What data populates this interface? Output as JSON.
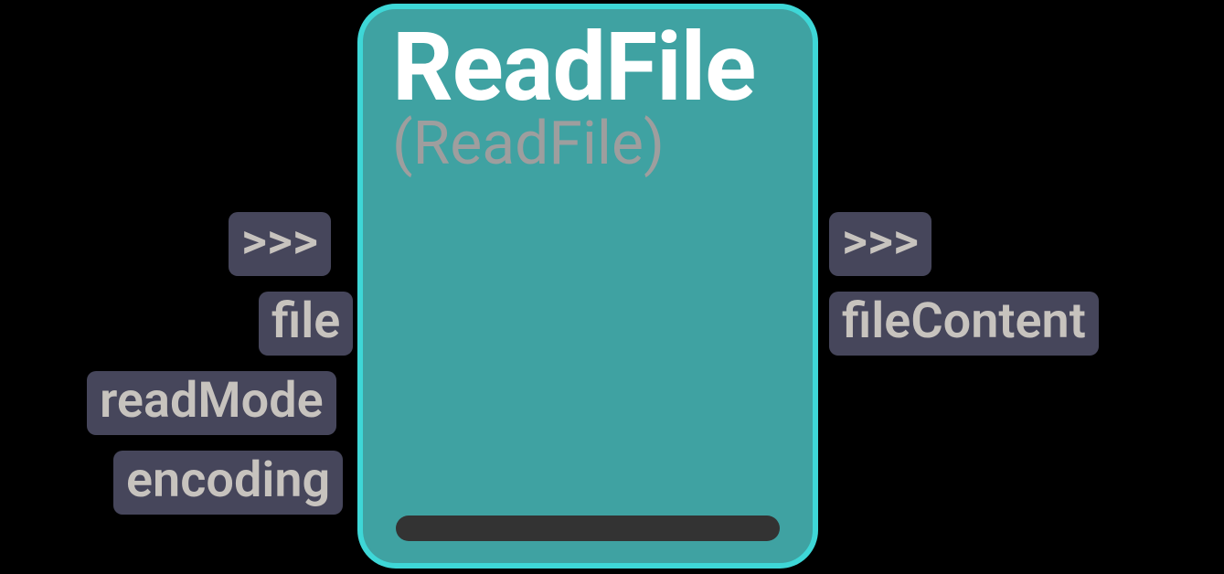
{
  "node": {
    "title": "ReadFile",
    "subtitle": "(ReadFile)"
  },
  "inputs": {
    "exec": ">>>",
    "file": "file",
    "readMode": "readMode",
    "encoding": "encoding"
  },
  "outputs": {
    "exec": ">>>",
    "fileContent": "fileContent"
  },
  "colors": {
    "nodeFill": "#3FA2A2",
    "nodeBorder": "#3ED7D7",
    "portBg": "#46465B",
    "portText": "#C7C3BE",
    "title": "#FFFFFF",
    "subtitle": "#9E9E9E",
    "bottomBar": "#333333",
    "background": "#000000"
  }
}
